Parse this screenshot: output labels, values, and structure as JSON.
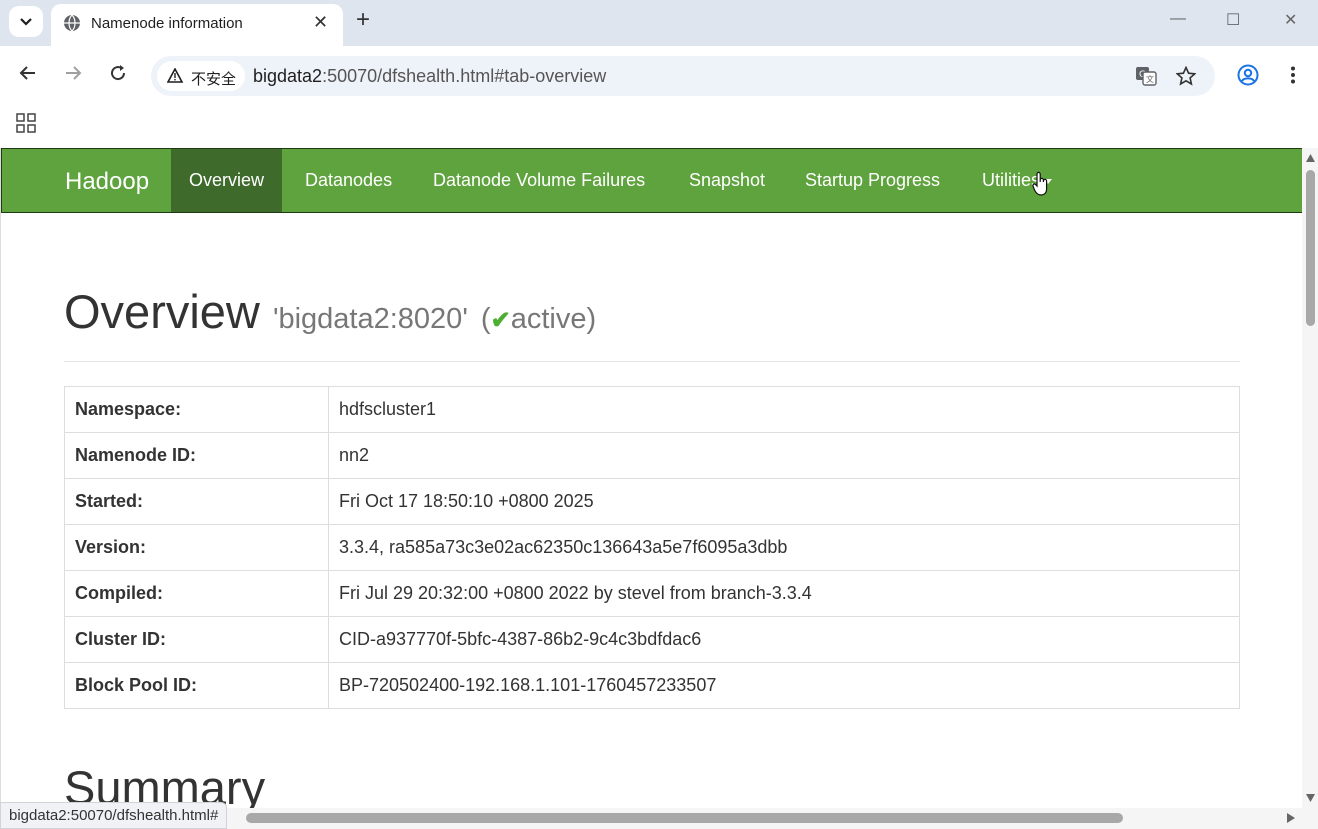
{
  "browser": {
    "tab_title": "Namenode information",
    "security_label": "不安全",
    "url_host": "bigdata2",
    "url_rest": ":50070/dfshealth.html#tab-overview",
    "status_url": "bigdata2:50070/dfshealth.html#"
  },
  "navbar": {
    "brand": "Hadoop",
    "items": [
      {
        "label": "Overview",
        "active": true
      },
      {
        "label": "Datanodes"
      },
      {
        "label": "Datanode Volume Failures"
      },
      {
        "label": "Snapshot"
      },
      {
        "label": "Startup Progress"
      },
      {
        "label": "Utilities"
      }
    ]
  },
  "header": {
    "title": "Overview",
    "host": "'bigdata2:8020'",
    "state_open": "(",
    "state": "active)"
  },
  "info": {
    "rows": [
      {
        "key": "Namespace:",
        "value": "hdfscluster1"
      },
      {
        "key": "Namenode ID:",
        "value": "nn2"
      },
      {
        "key": "Started:",
        "value": "Fri Oct 17 18:50:10 +0800 2025"
      },
      {
        "key": "Version:",
        "value": "3.3.4, ra585a73c3e02ac62350c136643a5e7f6095a3dbb"
      },
      {
        "key": "Compiled:",
        "value": "Fri Jul 29 20:32:00 +0800 2022 by stevel from branch-3.3.4"
      },
      {
        "key": "Cluster ID:",
        "value": "CID-a937770f-5bfc-4387-86b2-9c4c3bdfdac6"
      },
      {
        "key": "Block Pool ID:",
        "value": "BP-720502400-192.168.1.101-1760457233507"
      }
    ]
  },
  "summary_title": "Summary"
}
